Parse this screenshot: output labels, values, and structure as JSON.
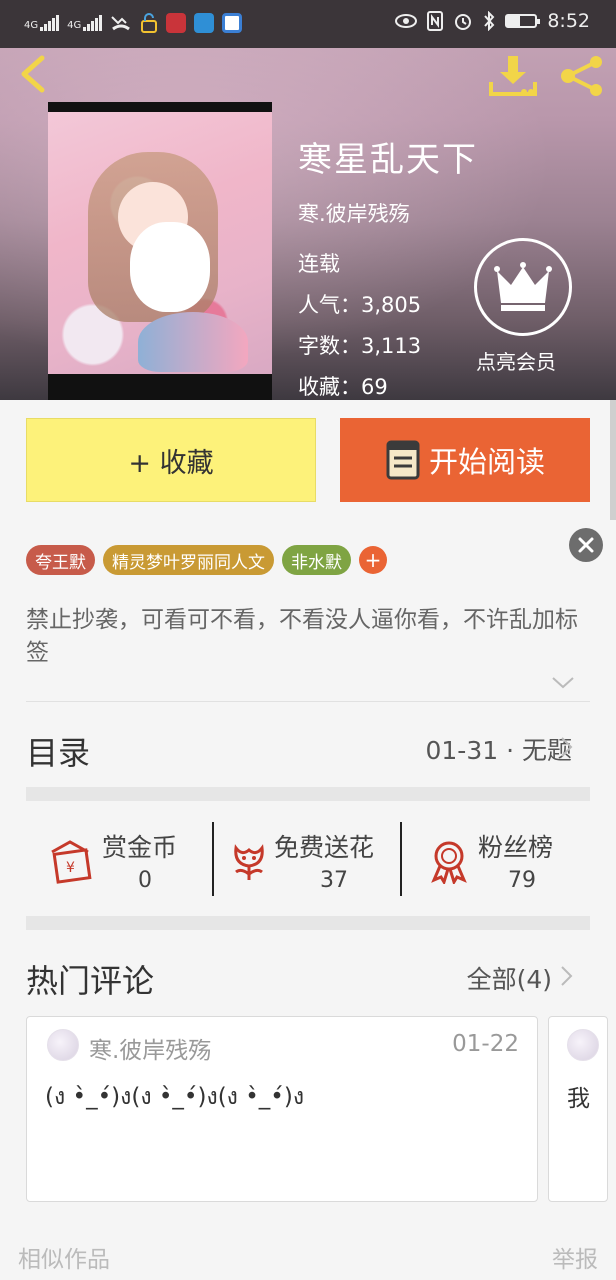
{
  "status_bar": {
    "signal1": "4G",
    "signal2": "4G",
    "time": "8:52",
    "icons": [
      "signal-icon",
      "signal-icon",
      "missed-call-icon",
      "lock-icon",
      "app-icon",
      "app-icon",
      "app-icon",
      "eye-icon",
      "nfc-icon",
      "alarm-icon",
      "bluetooth-icon",
      "battery-icon"
    ],
    "battery_level": 0.45
  },
  "header": {
    "back_icon": "chevron-left-icon",
    "download_icon": "download-icon",
    "share_icon": "share-icon",
    "accent": "#f2d548"
  },
  "book": {
    "title": "寒星乱天下",
    "author": "寒.彼岸残殇",
    "status": "连载",
    "popularity": "人气：3,805",
    "words": "字数：3,113",
    "favorites": "收藏：69",
    "vip_label": "点亮会员"
  },
  "actions": {
    "collect_label": "+ 收藏",
    "read_label": "开始阅读",
    "collect_color": "#fdf27a",
    "read_color": "#ea6434"
  },
  "tags": [
    {
      "label": "夸王默",
      "color": "#c75b4a"
    },
    {
      "label": "精灵梦叶罗丽同人文",
      "color": "#c99a34"
    },
    {
      "label": "非水默",
      "color": "#7fa443"
    }
  ],
  "tag_add": "+",
  "description": "禁止抄袭，可看可不看，不看没人逼你看，不许乱加标签",
  "toc": {
    "title": "目录",
    "latest": "01-31 · 无题"
  },
  "stats": [
    {
      "label": "赏金币",
      "value": "0",
      "icon": "red-envelope-icon"
    },
    {
      "label": "免费送花",
      "value": "37",
      "icon": "flower-icon"
    },
    {
      "label": "粉丝榜",
      "value": "79",
      "icon": "medal-icon"
    }
  ],
  "comments": {
    "title": "热门评论",
    "all_label": "全部(4)",
    "items": [
      {
        "user": "寒.彼岸残殇",
        "date": "01-22",
        "text": "(ง •̀_•́)ง(ง •̀_•́)ง(ง •̀_•́)ง"
      },
      {
        "user": "",
        "date": "",
        "text": "我"
      }
    ]
  },
  "footer": {
    "similar": "相似作品",
    "report": "举报"
  }
}
